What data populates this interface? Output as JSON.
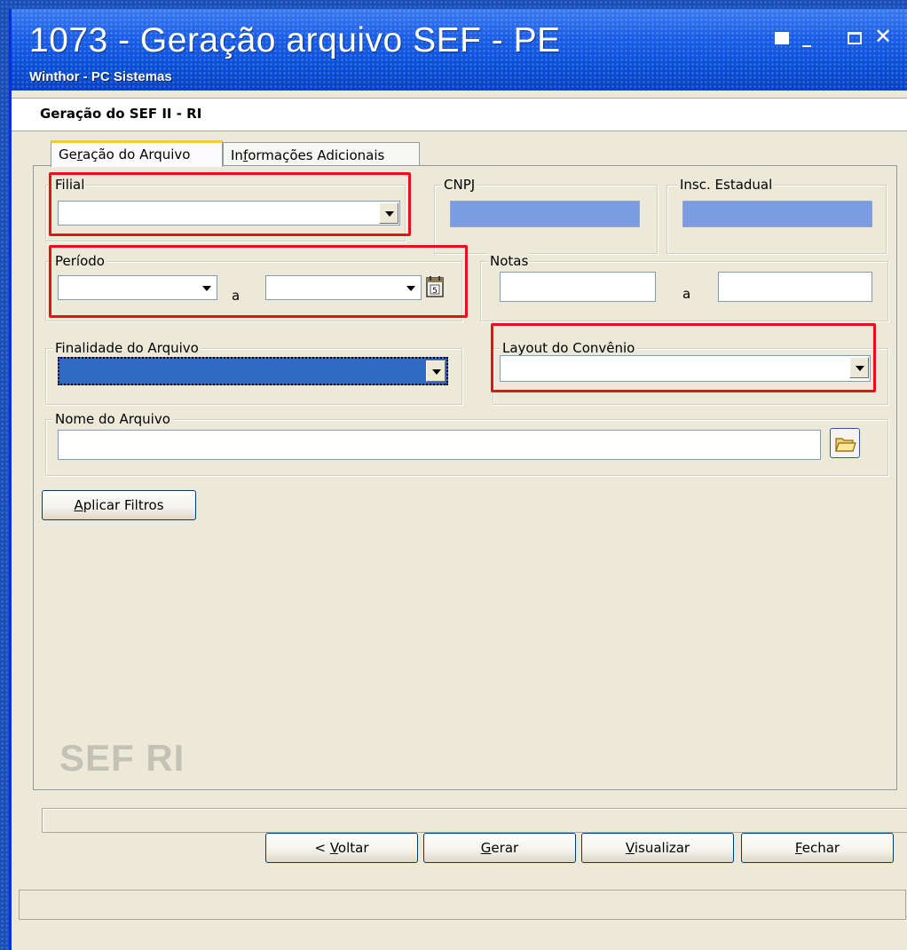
{
  "window": {
    "title": "1073 - Geração arquivo SEF - PE",
    "subtitle": "Winthor - PC Sistemas",
    "controls": [
      "restore",
      "minimize",
      "maximize",
      "close"
    ],
    "close_glyph": "✕",
    "minimize_glyph": "_"
  },
  "header": {
    "title": "Geração do SEF II - RI"
  },
  "tabs": [
    {
      "label_pre": "Ge",
      "label_mnemonic": "r",
      "label_post": "ação do Arquivo",
      "active": true
    },
    {
      "label_pre": "In",
      "label_mnemonic": "f",
      "label_post": "ormações Adicionais",
      "active": false
    }
  ],
  "form": {
    "filial": {
      "label": "Filial",
      "value": ""
    },
    "cnpj": {
      "label": "CNPJ",
      "value": ""
    },
    "inscricao": {
      "label": "Insc. Estadual",
      "value": ""
    },
    "periodo": {
      "label": "Período",
      "from": "",
      "to": "",
      "separator": "a"
    },
    "notas": {
      "label": "Notas",
      "from": "",
      "to": "",
      "separator": "a"
    },
    "finalidade": {
      "label": "Finalidade do Arquivo",
      "value": ""
    },
    "layout": {
      "label": "Layout do Convênio",
      "value": ""
    },
    "nome_arquivo": {
      "label": "Nome do Arquivo",
      "value": ""
    }
  },
  "buttons": {
    "aplicar_filtros": {
      "mnemonic": "A",
      "rest": "plicar Filtros"
    },
    "voltar": {
      "pre": "< ",
      "mnemonic": "V",
      "rest": "oltar"
    },
    "gerar": {
      "mnemonic": "G",
      "rest": "erar"
    },
    "visualizar": {
      "mnemonic": "V",
      "rest": "isualizar"
    },
    "fechar": {
      "mnemonic": "F",
      "rest": "echar"
    }
  },
  "watermark": "SEF RI",
  "icons": {
    "calendar": "calendar-icon",
    "folder": "folder-icon",
    "dropdown": "chevron-down-icon"
  },
  "colors": {
    "titlebar": "#0a4fd8",
    "highlight_box": "#e8101a",
    "readonly_field": "#7b9ce0",
    "selected_combo": "#316ac5"
  }
}
